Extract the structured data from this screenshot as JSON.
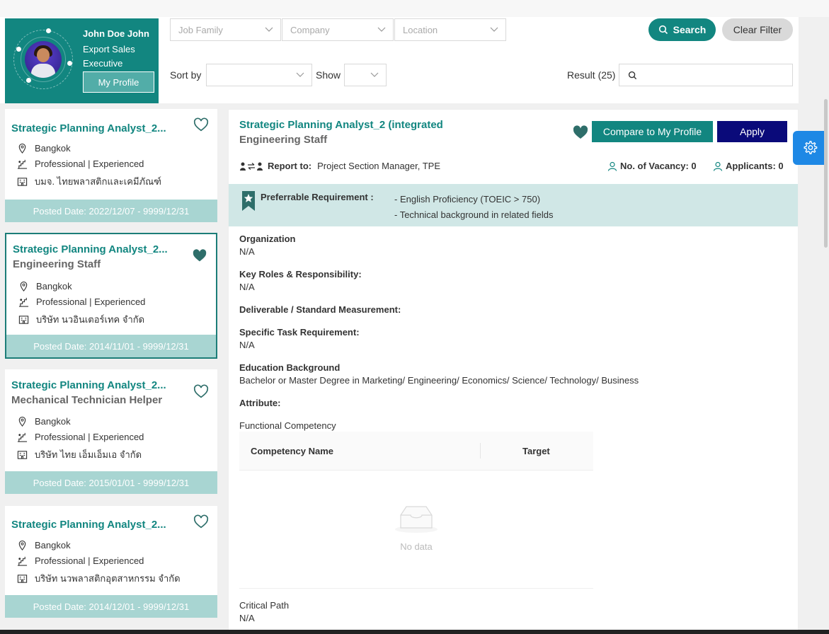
{
  "profile": {
    "name": "John Doe John",
    "title": "Export Sales Executive",
    "button": "My Profile"
  },
  "filters": {
    "job_family": "Job Family",
    "company": "Company",
    "location": "Location",
    "sort_label": "Sort by",
    "sort_value": "",
    "show_label": "Show",
    "show_value": "",
    "search_button": "Search",
    "clear_button": "Clear Filter",
    "result_label": "Result (25)",
    "search_value": ""
  },
  "cards": [
    {
      "title": "Strategic Planning Analyst_2...",
      "subtitle": "",
      "location": "Bangkok",
      "level": "Professional | Experienced",
      "company": "บมจ. ไทยพลาสติกและเคมีภัณฑ์",
      "posted": "Posted Date: 2022/12/07 - 9999/12/31",
      "favorite": false
    },
    {
      "title": "Strategic Planning Analyst_2...",
      "subtitle": "Engineering Staff",
      "location": "Bangkok",
      "level": "Professional | Experienced",
      "company": "บริษัท นวอินเตอร์เทค จำกัด",
      "posted": "Posted Date: 2014/11/01 - 9999/12/31",
      "favorite": true
    },
    {
      "title": "Strategic Planning Analyst_2...",
      "subtitle": "Mechanical Technician Helper",
      "location": "Bangkok",
      "level": "Professional | Experienced",
      "company": "บริษัท ไทย เอ็มเอ็มเอ จำกัด",
      "posted": "Posted Date: 2015/01/01 - 9999/12/31",
      "favorite": false
    },
    {
      "title": "Strategic Planning Analyst_2...",
      "subtitle": "",
      "location": "Bangkok",
      "level": "Professional | Experienced",
      "company": "บริษัท นวพลาสติกอุตสาหกรรม จำกัด",
      "posted": "Posted Date: 2014/12/01 - 9999/12/31",
      "favorite": false
    }
  ],
  "detail": {
    "title": "Strategic Planning Analyst_2 (integrated",
    "subtitle": "Engineering Staff",
    "compare_button": "Compare to My Profile",
    "apply_button": "Apply",
    "report_label": "Report to:",
    "report_value": "Project Section Manager, TPE",
    "vacancy": "No. of Vacancy: 0",
    "applicants": "Applicants: 0",
    "pref_label": "Preferrable Requirement :",
    "pref_items": [
      "- English Proficiency (TOEIC > 750)",
      "- Technical background in related fields"
    ],
    "sections": {
      "organization": {
        "label": "Organization",
        "value": "N/A"
      },
      "roles": {
        "label": "Key Roles & Responsibility:",
        "value": "N/A"
      },
      "deliverable": {
        "label": "Deliverable / Standard Measurement:",
        "value": ""
      },
      "specific": {
        "label": "Specific Task Requirement:",
        "value": "N/A"
      },
      "education": {
        "label": "Education Background",
        "value": "Bachelor or Master Degree in Marketing/ Engineering/ Economics/ Science/ Technology/ Business"
      },
      "attribute": {
        "label": "Attribute:",
        "value": ""
      },
      "functional": {
        "label": "Functional Competency",
        "value": ""
      },
      "critical": {
        "label": "Critical Path",
        "value": "N/A"
      }
    },
    "competency_table": {
      "col1": "Competency Name",
      "col2": "Target",
      "empty": "No data"
    }
  },
  "colors": {
    "primary": "#128680",
    "apply": "#0a0a7a",
    "posted_bg": "#a8d5d2",
    "pref_bg": "#d0e7e6",
    "gear": "#1e88e5"
  }
}
